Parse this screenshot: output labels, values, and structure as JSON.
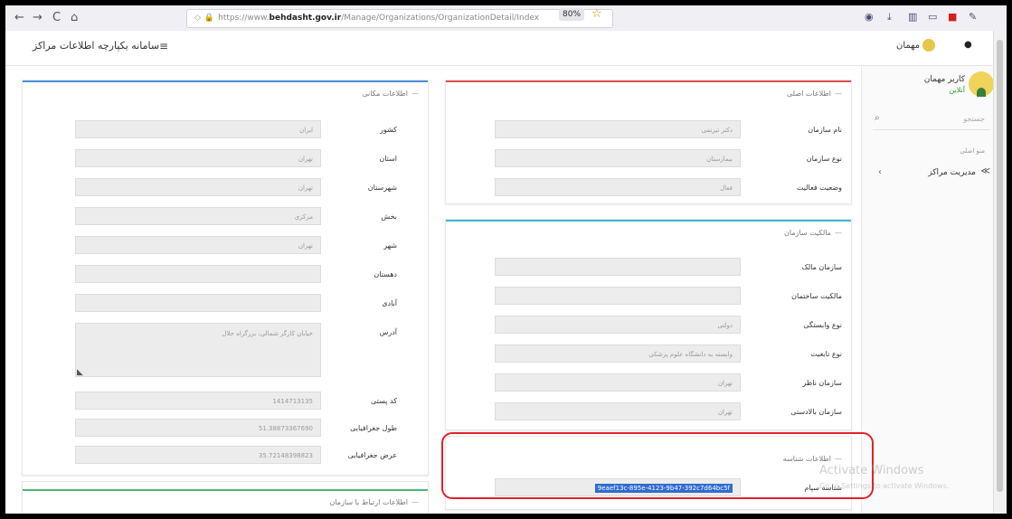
{
  "browser": {
    "back": "←",
    "forward": "→",
    "reload": "C",
    "home": "⌂",
    "url_prefix": "https://www.",
    "url_domain": "behdasht.gov.ir",
    "url_rest": "/Manage/Organizations/OrganizationDetail/Index",
    "zoom": "80%"
  },
  "app": {
    "title": "سامانه یکپارچه اطلاعات مراکز",
    "menu_icon": "≡",
    "profile_name": "مهمان",
    "more_icon": "●"
  },
  "sidebar": {
    "user_name": "کاربر مهمان",
    "status": "آنلاین",
    "search_placeholder": "جستجو",
    "section_label": "منو اصلی",
    "menu_item": "مدیریت مراکز"
  },
  "watermark": {
    "line1": "Activate Windows",
    "line2": "Go to Settings to activate Windows."
  },
  "main_info": {
    "title": "اطلاعات اصلی",
    "rows": [
      {
        "label": "نام سازمان",
        "value": "دکتر تیرنمی"
      },
      {
        "label": "نوع سازمان",
        "value": "بیمارستان"
      },
      {
        "label": "وضعیت فعالیت",
        "value": "فعال"
      }
    ]
  },
  "ownership": {
    "title": "مالکیت سازمان",
    "rows": [
      {
        "label": "سازمان مالک",
        "value": ""
      },
      {
        "label": "مالکیت ساختمان",
        "value": ""
      },
      {
        "label": "نوع وابستگی",
        "value": "دولتی"
      },
      {
        "label": "نوع تابعیت",
        "value": "وابسته به دانشگاه علوم پزشکی"
      },
      {
        "label": "سازمان ناظر",
        "value": "تهران"
      },
      {
        "label": "سازمان بالادستی",
        "value": "تهران"
      }
    ]
  },
  "extra_info": {
    "title": "اطلاعات شناسه",
    "rows": [
      {
        "label": "شناسه سپام",
        "value": "9eaef13c-895e-4123-9b47-392c7d64bc5f"
      }
    ]
  },
  "location": {
    "title": "اطلاعات مکانی",
    "rows": [
      {
        "label": "کشور",
        "value": "ایران"
      },
      {
        "label": "استان",
        "value": "تهران"
      },
      {
        "label": "شهرستان",
        "value": "تهران"
      },
      {
        "label": "بخش",
        "value": "مرکزی"
      },
      {
        "label": "شهر",
        "value": "تهران"
      },
      {
        "label": "دهستان",
        "value": ""
      },
      {
        "label": "آبادی",
        "value": ""
      },
      {
        "label": "آدرس",
        "value": "خیابان کارگر شمالی، بزرگراه جلال"
      },
      {
        "label": "کد پستی",
        "value": "1414713135"
      },
      {
        "label": "طول جغرافیایی",
        "value": "51.38873367690"
      },
      {
        "label": "عرض جغرافیایی",
        "value": "35.72148398823"
      }
    ]
  },
  "contact": {
    "title": "اطلاعات ارتباط با سازمان"
  },
  "colors": {
    "main_info_accent": "#e05050",
    "ownership_accent": "#3cb8c8",
    "location_accent": "#4a8fd8",
    "contact_accent": "#4ab87a",
    "highlight": "#e0222a"
  }
}
